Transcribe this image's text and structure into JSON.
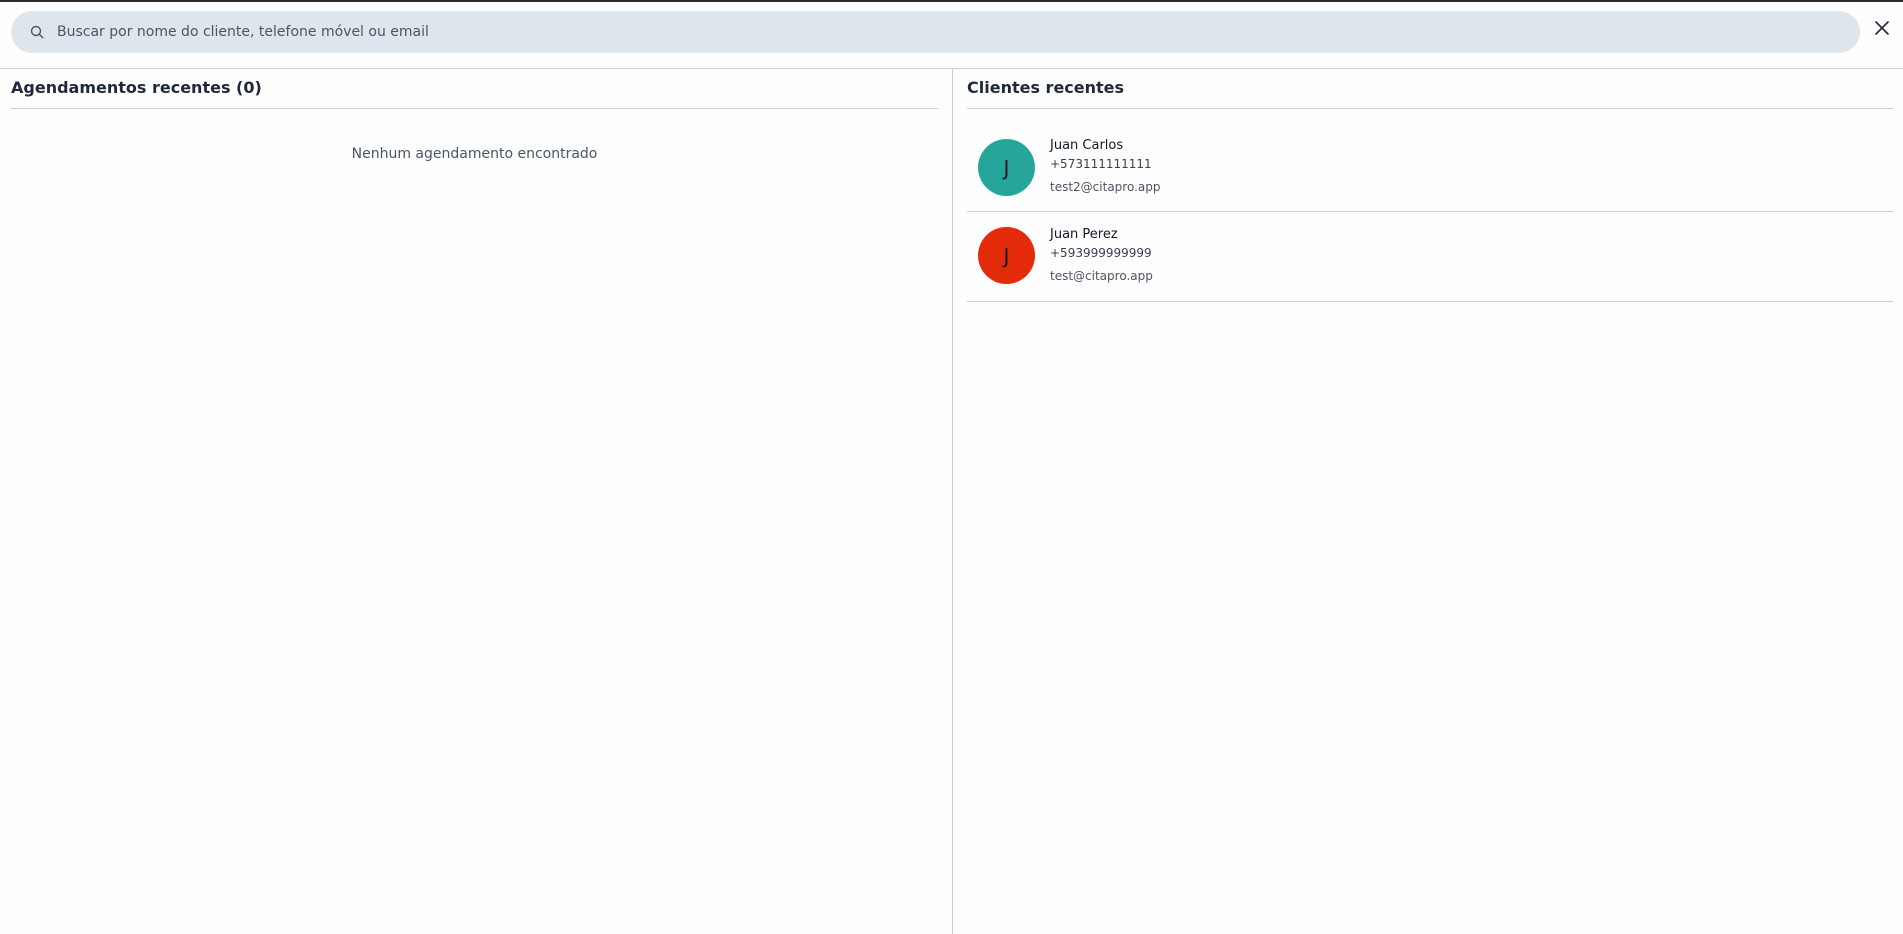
{
  "search": {
    "placeholder": "Buscar por nome do cliente, telefone móvel ou email",
    "value": ""
  },
  "icons": {
    "search": "search-icon",
    "close": "close-icon"
  },
  "appointments": {
    "title": "Agendamentos recentes (0)",
    "empty_message": "Nenhum agendamento encontrado"
  },
  "clients": {
    "title": "Clientes recentes",
    "items": [
      {
        "initial": "J",
        "name": "Juan Carlos",
        "phone": "+573111111111",
        "email": "test2@citapro.app",
        "avatar_color": "#26a69a"
      },
      {
        "initial": "J",
        "name": "Juan Perez",
        "phone": "+593999999999",
        "email": "test@citapro.app",
        "avatar_color": "#e32b0c"
      }
    ]
  }
}
